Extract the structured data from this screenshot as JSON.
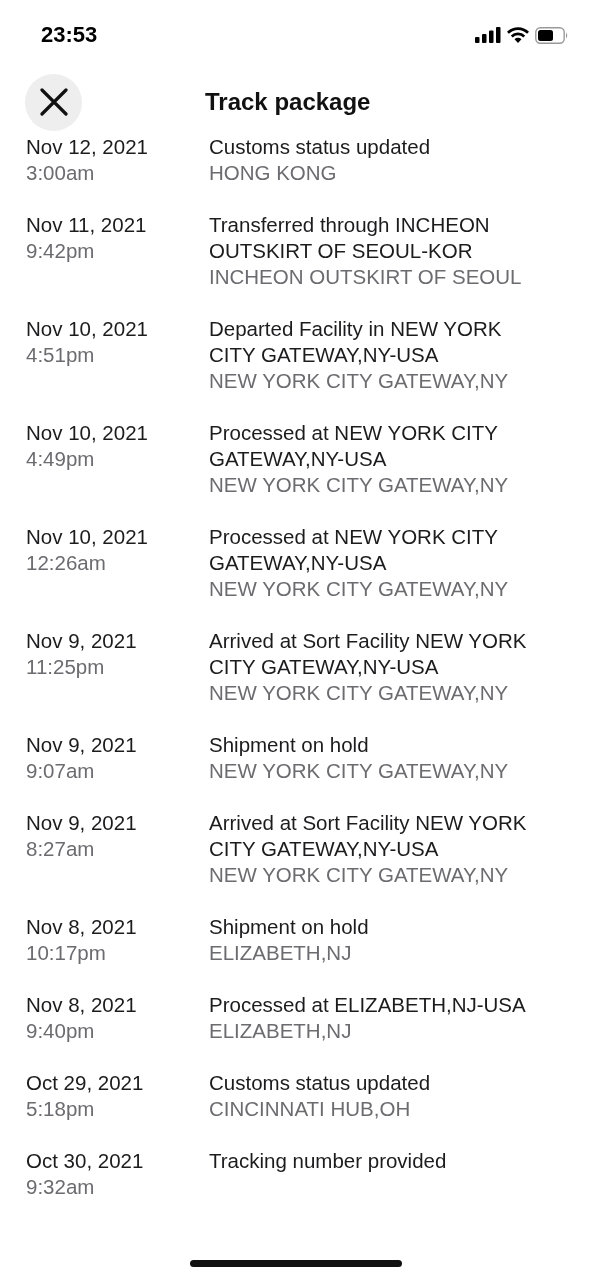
{
  "status_bar": {
    "time": "23:53"
  },
  "header": {
    "title": "Track package"
  },
  "events": [
    {
      "date": "Nov 12, 2021",
      "time": "3:00am",
      "description": "Customs status updated",
      "location": "HONG KONG"
    },
    {
      "date": "Nov 11, 2021",
      "time": "9:42pm",
      "description": "Transferred through INCHEON OUTSKIRT OF SEOUL-KOR",
      "location": "INCHEON OUTSKIRT OF SEOUL"
    },
    {
      "date": "Nov 10, 2021",
      "time": "4:51pm",
      "description": "Departed Facility in NEW YORK CITY GATEWAY,NY-USA",
      "location": "NEW YORK CITY GATEWAY,NY"
    },
    {
      "date": "Nov 10, 2021",
      "time": "4:49pm",
      "description": "Processed at NEW YORK CITY GATEWAY,NY-USA",
      "location": "NEW YORK CITY GATEWAY,NY"
    },
    {
      "date": "Nov 10, 2021",
      "time": "12:26am",
      "description": "Processed at NEW YORK CITY GATEWAY,NY-USA",
      "location": "NEW YORK CITY GATEWAY,NY"
    },
    {
      "date": "Nov 9, 2021",
      "time": "11:25pm",
      "description": "Arrived at Sort Facility NEW YORK CITY GATEWAY,NY-USA",
      "location": "NEW YORK CITY GATEWAY,NY"
    },
    {
      "date": "Nov 9, 2021",
      "time": "9:07am",
      "description": "Shipment on hold",
      "location": "NEW YORK CITY GATEWAY,NY"
    },
    {
      "date": "Nov 9, 2021",
      "time": "8:27am",
      "description": "Arrived at Sort Facility NEW YORK CITY GATEWAY,NY-USA",
      "location": "NEW YORK CITY GATEWAY,NY"
    },
    {
      "date": "Nov 8, 2021",
      "time": "10:17pm",
      "description": "Shipment on hold",
      "location": "ELIZABETH,NJ"
    },
    {
      "date": "Nov 8, 2021",
      "time": "9:40pm",
      "description": "Processed at ELIZABETH,NJ-USA",
      "location": "ELIZABETH,NJ"
    },
    {
      "date": "Oct 29, 2021",
      "time": "5:18pm",
      "description": "Customs status updated",
      "location": "CINCINNATI HUB,OH"
    },
    {
      "date": "Oct 30, 2021",
      "time": "9:32am",
      "description": "Tracking number provided"
    }
  ]
}
